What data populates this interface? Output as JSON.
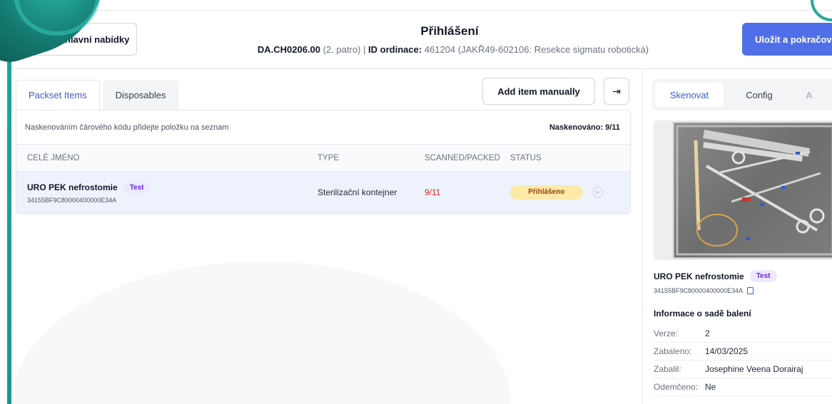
{
  "header": {
    "back_label": "hlavní nabídky",
    "title": "Přihlášení",
    "location_code": "DA.CH0206.00",
    "location_floor": "(2. patro)",
    "separator": "|",
    "ordinace_label": "ID ordinace:",
    "ordinace_value": "461204 (JAKŘ49-602106: Resekce sigmatu robotická)",
    "save_label": "Uložit a pokračovat"
  },
  "left": {
    "tabs": [
      {
        "label": "Packset Items",
        "active": true
      },
      {
        "label": "Disposables",
        "active": false
      }
    ],
    "add_label": "Add item manually",
    "collapse_icon": "collapse-right-icon",
    "info_text": "Naskenováním čárového kódu přidejte položku na seznam",
    "scanned_count": "Naskenováno: 9/11",
    "columns": [
      "CELÉ JMÉNO",
      "TYPE",
      "SCANNED/PACKED",
      "STATUS"
    ],
    "rows": [
      {
        "name": "URO PEK nefrostomie",
        "badge": "Test",
        "code": "34155BF9C80000400000E34A",
        "type": "Sterilizační kontejner",
        "scanned": "9/11",
        "status": "Přihlášeno"
      }
    ]
  },
  "right": {
    "tabs": [
      {
        "label": "Skenovat",
        "active": true
      },
      {
        "label": "Config",
        "active": false
      },
      {
        "label": "A",
        "active": false
      }
    ],
    "item_name": "URO PEK nefrostomie",
    "badge": "Test",
    "code": "34155BF9C80000400000E34A",
    "pack_title": "Informace o sadě balení",
    "meta": [
      {
        "key": "Verze:",
        "value": "2"
      },
      {
        "key": "Zabaleno:",
        "value": "14/03/2025"
      },
      {
        "key": "Zabalil:",
        "value": "Josephine Veena Dorairaj"
      },
      {
        "key": "Odemčeno:",
        "value": "Ne"
      }
    ]
  },
  "colors": {
    "accent": "#4f6fe8",
    "teal": "#1c9688",
    "status_bg": "#fde9a8",
    "badge_bg": "#ede9fe"
  }
}
